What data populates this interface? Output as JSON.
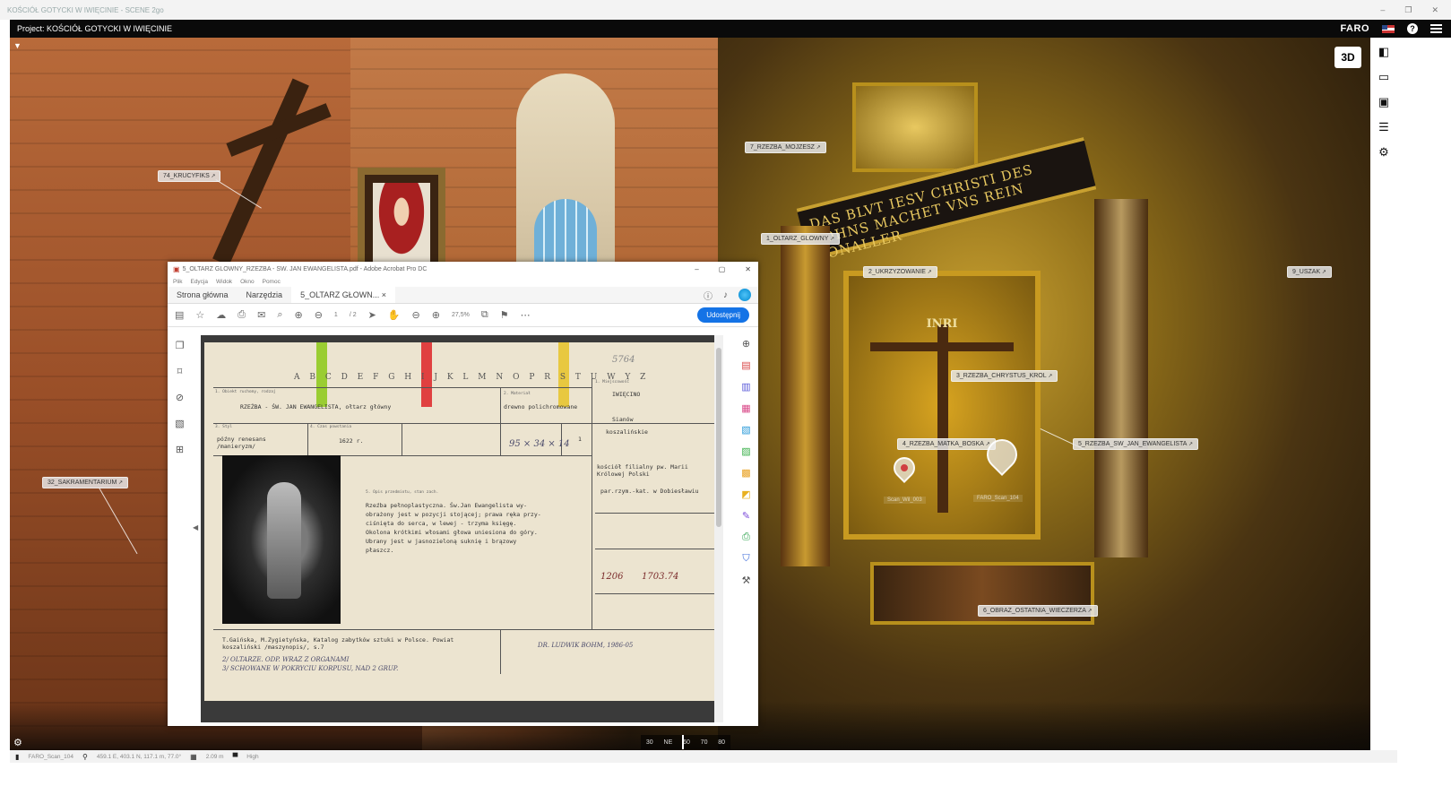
{
  "os_window": {
    "title": "KOŚCIÓŁ GOTYCKI W IWIĘCINIE - SCENE 2go",
    "controls": [
      "–",
      "❐",
      "✕"
    ]
  },
  "app_header": {
    "project_label": "Project: KOŚCIÓŁ GOTYCKI W IWIĘCINIE",
    "brand": "FARO",
    "help_label": "?"
  },
  "viewport": {
    "view_3d_label": "3D",
    "banner_text": "DAS BLVT IESV CHRISTI DES SOHNS MACHET VNS REIN VONALLER",
    "inri_text": "INRI",
    "hotspots": [
      {
        "label": "74_KRUCYFIKS"
      },
      {
        "label": "7_RZEZBA_MOJZESZ"
      },
      {
        "label": "1_OLTARZ_GLOWNY"
      },
      {
        "label": "2_UKRZYZOWANIE"
      },
      {
        "label": "9_USZAK"
      },
      {
        "label": "3_RZEZBA_CHRYSTUS_KROL"
      },
      {
        "label": "4_RZEZBA_MATKA_BOSKA"
      },
      {
        "label": "5_RZEZBA_SW_JAN_EWANGELISTA"
      },
      {
        "label": "32_SAKRAMENTARIUM"
      },
      {
        "label": "6_OBRAZ_OSTATNIA_WIECZERZA"
      }
    ],
    "scan_markers": [
      {
        "label": "Scan_Wil_003"
      },
      {
        "label": "FARO_Scan_104"
      }
    ],
    "compass": [
      "30",
      "NE",
      "60",
      "70",
      "80"
    ]
  },
  "right_toolbar": {
    "icons": [
      "book-icon",
      "map-icon",
      "image-icon",
      "list-icon",
      "gear-icon"
    ]
  },
  "status_bar": {
    "scan_name": "FARO_Scan_104",
    "coordinates": "459.1 E, 403.1 N, 117.1 m, 77.0°",
    "measurement": "2.09 m",
    "mode": "High"
  },
  "acrobat": {
    "title": "5_OLTARZ GLOWNY_RZEZBA - SW. JAN EWANGELISTA.pdf - Adobe Acrobat Pro DC",
    "menu": [
      "Plik",
      "Edycja",
      "Widok",
      "Okno",
      "Pomoc"
    ],
    "tabs": [
      "Strona główna",
      "Narzędzia",
      "5_OLTARZ GŁOWN..."
    ],
    "page_current": "1",
    "page_total": "/ 2",
    "zoom": "27,5%",
    "share_label": "Udostępnij"
  },
  "card": {
    "alphabet": "A B C D E F G H I J K L M N O P R S T U W Y Z",
    "number_hand": "5764",
    "location_header": "1. Miejscowość",
    "location": "IWIĘCINO",
    "object_header": "1. Obiekt ruchomy, rodzaj",
    "object": "RZEŹBA - ŚW. JAN EWANGELISTA, ołtarz główny",
    "county": "Sianów",
    "province": "koszalińskie",
    "material_header": "2. Materiał",
    "material": "drewno polichromowane",
    "style_header": "3. Styl",
    "style": "późny renesans /manieryzm/",
    "date_header": "4. Czas powstania",
    "date": "1622 r.",
    "dimensions": "95 × 34 × 14",
    "count": "1",
    "owner": "kościół filialny pw. Marii Królowej Polski",
    "parish": "par.rzym.-kat. w Dobiesławiu",
    "description_header": "5. Opis przedmiotu, stan zach.",
    "description": [
      "Rzeźba pełnoplastyczna. Św.Jan Ewangelista wy-",
      "obrażony jest w pozycji stojącej; prawa ręka przy-",
      "ciśnięta do serca, w lewej - trzyma księgę.",
      "Okolona krótkimi włosami głowa uniesiona do góry.",
      "Ubrany jest w jasnozieloną suknię i brązowy",
      "płaszcz."
    ],
    "catalog_hand": [
      "1206",
      "1703.74"
    ],
    "bibliography": "T.Gaińska, M.Zygietyńska, Katalog zabytków sztuki w Polsce. Powiat koszaliński /maszynopis/, s.7",
    "notes_hand": [
      "2/ OLTARZE. ODP. WRAZ Z ORGANAMI",
      "3/ SCHOWANE W POKRYCIU KORPUSU, NAD 2 GRUP."
    ],
    "author_hand": "DR. LUDWIK BOHM, 1986-05"
  }
}
